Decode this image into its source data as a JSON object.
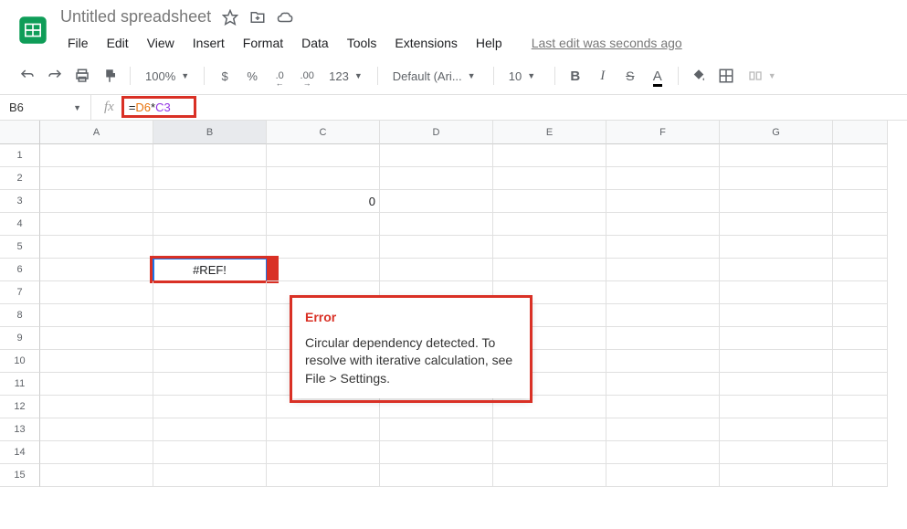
{
  "doc": {
    "title": "Untitled spreadsheet"
  },
  "menu": {
    "file": "File",
    "edit": "Edit",
    "view": "View",
    "insert": "Insert",
    "format": "Format",
    "data": "Data",
    "tools": "Tools",
    "extensions": "Extensions",
    "help": "Help",
    "last_edit": "Last edit was seconds ago"
  },
  "toolbar": {
    "zoom": "100%",
    "currency": "$",
    "percent": "%",
    "dec_dec": ".0",
    "inc_dec": ".00",
    "more_fmt": "123",
    "font": "Default (Ari...",
    "font_size": "10",
    "bold": "B",
    "italic": "I",
    "strike": "S",
    "text_color": "A"
  },
  "namebox": {
    "cell": "B6"
  },
  "formula": {
    "prefix": "=",
    "ref1": "D6",
    "op": "*",
    "ref2": "C3"
  },
  "columns": [
    "A",
    "B",
    "C",
    "D",
    "E",
    "F",
    "G"
  ],
  "rows": [
    "1",
    "2",
    "3",
    "4",
    "5",
    "6",
    "7",
    "8",
    "9",
    "10",
    "11",
    "12",
    "13",
    "14",
    "15"
  ],
  "cells": {
    "C3": "0",
    "B6": "#REF!"
  },
  "error_tooltip": {
    "title": "Error",
    "body": "Circular dependency detected. To resolve with iterative calculation, see File > Settings."
  }
}
